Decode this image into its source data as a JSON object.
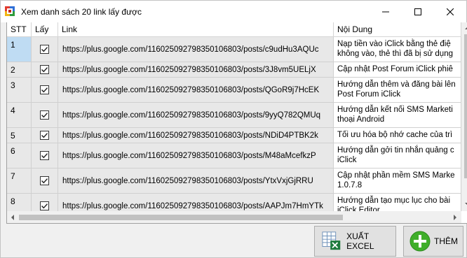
{
  "window": {
    "title": "Xem danh sách 20 link lấy được",
    "controls": {
      "minimize": "minimize",
      "maximize": "maximize",
      "close": "close"
    }
  },
  "table": {
    "headers": {
      "stt": "STT",
      "lay": "Lấy",
      "link": "Link",
      "content": "Nội Dung"
    },
    "rows": [
      {
        "stt": "1",
        "checked": true,
        "selected": true,
        "link": "https://plus.google.com/116025092798350106803/posts/c9udHu3AQUc",
        "content": "Nạp tiền vào iClick bằng thẻ điệ\nkhông vào, thẻ thì đã bị sử dụng"
      },
      {
        "stt": "2",
        "checked": true,
        "link": "https://plus.google.com/116025092798350106803/posts/3J8vm5UELjX",
        "content": "Cập nhật Post Forum iClick phiê"
      },
      {
        "stt": "3",
        "checked": true,
        "link": "https://plus.google.com/116025092798350106803/posts/QGoR9j7HcEK",
        "content": "Hướng dẫn thêm và đăng bài lên\nPost Forum iClick"
      },
      {
        "stt": "4",
        "checked": true,
        "link": "https://plus.google.com/116025092798350106803/posts/9yyQ782QMUq",
        "content": "Hướng dẫn kết nối SMS Marketi\nthoại Android"
      },
      {
        "stt": "5",
        "checked": true,
        "link": "https://plus.google.com/116025092798350106803/posts/NDiD4PTBK2k",
        "content": "Tối ưu hóa bộ nhớ cache của trì"
      },
      {
        "stt": "6",
        "checked": true,
        "link": "https://plus.google.com/116025092798350106803/posts/M48aMcefkzP",
        "content": "Hướng dẫn gởi tin nhắn quảng c\niClick"
      },
      {
        "stt": "7",
        "checked": true,
        "link": "https://plus.google.com/116025092798350106803/posts/YtxVxjGjRRU",
        "content": "Cập nhật phần mềm SMS Marke\n1.0.7.8"
      },
      {
        "stt": "8",
        "checked": true,
        "link": "https://plus.google.com/116025092798350106803/posts/AAPJm7HmYTk",
        "content": "Hướng dẫn tạo mục lục cho bài\niClick Editor"
      }
    ]
  },
  "buttons": {
    "export": "XUẤT EXCEL",
    "add": "THÊM"
  },
  "icons": {
    "app": "app-logo-icon",
    "excel": "excel-export-icon",
    "add": "plus-circle-icon"
  },
  "colors": {
    "selected_row": "#bfdcf3",
    "cell_bg": "#e8e8e8",
    "accent_green": "#3fae2a"
  }
}
